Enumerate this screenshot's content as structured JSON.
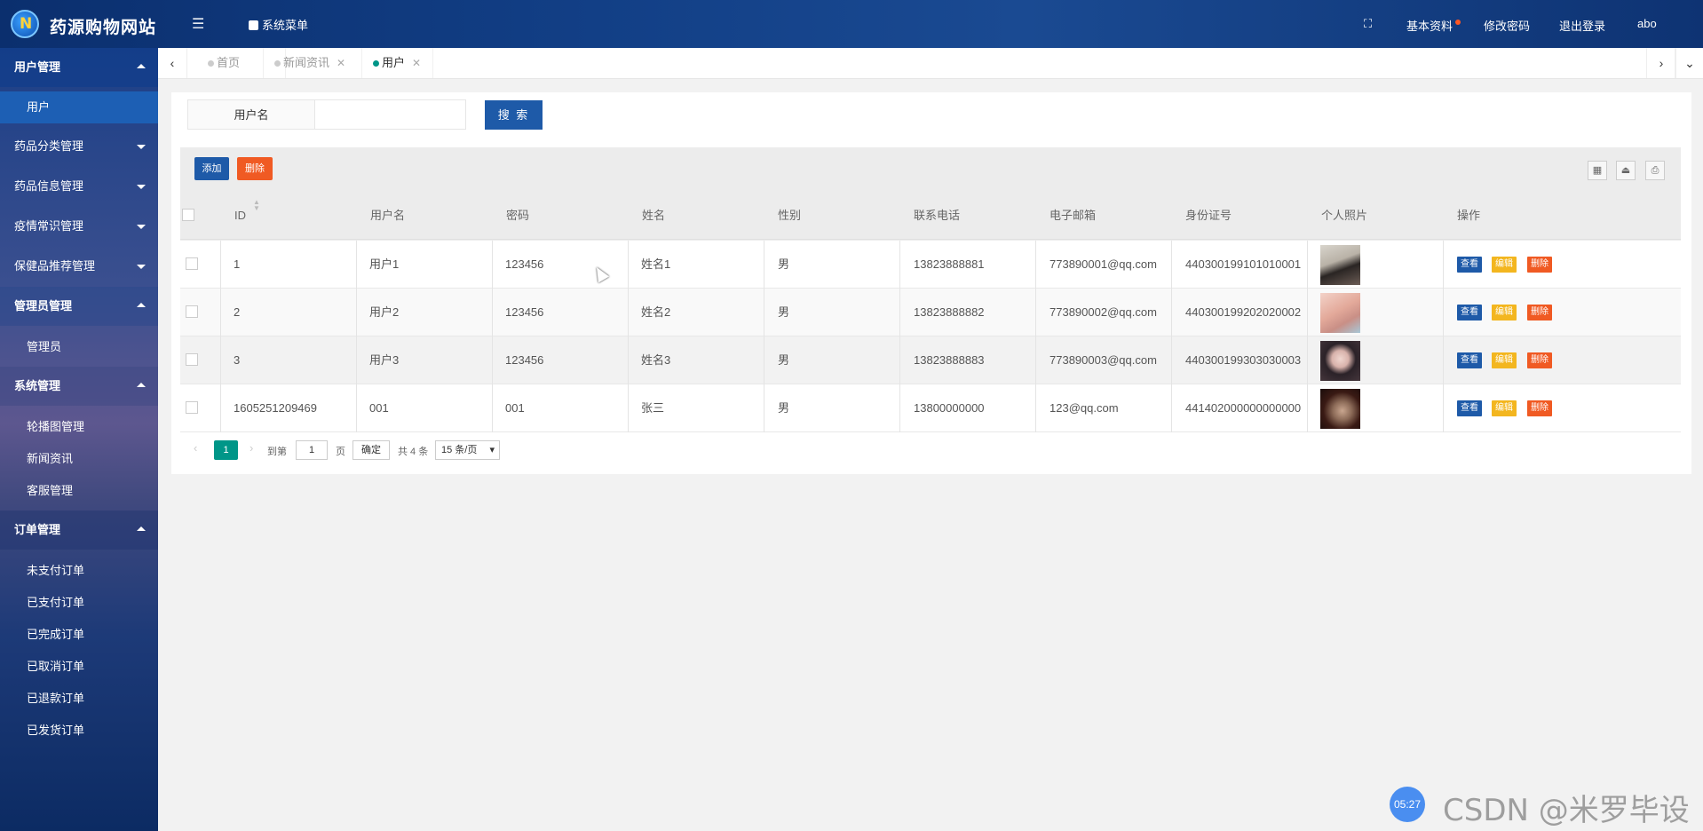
{
  "header": {
    "brand": "药源购物网站",
    "menu_toggle_icon": "list-icon",
    "system_menu": "系统菜单",
    "fullscreen_icon": "fullscreen-icon",
    "profile": "基本资料",
    "change_password": "修改密码",
    "logout": "退出登录",
    "username": "abo"
  },
  "sidebar": {
    "groups": [
      {
        "label": "用户管理",
        "items": [
          "用户"
        ]
      },
      {
        "label": "药品分类管理"
      },
      {
        "label": "药品信息管理"
      },
      {
        "label": "疫情常识管理"
      },
      {
        "label": "保健品推荐管理"
      },
      {
        "label": "管理员管理",
        "items": [
          "管理员"
        ]
      },
      {
        "label": "系统管理",
        "items": [
          "轮播图管理",
          "新闻资讯",
          "客服管理"
        ]
      },
      {
        "label": "订单管理",
        "items": [
          "未支付订单",
          "已支付订单",
          "已完成订单",
          "已取消订单",
          "已退款订单",
          "已发货订单"
        ]
      }
    ]
  },
  "tabs": [
    {
      "label": "首页"
    },
    {
      "label": "新闻资讯"
    },
    {
      "label": "用户"
    }
  ],
  "search": {
    "label": "用户名",
    "value": "",
    "button": "搜 索"
  },
  "toolbar": {
    "add": "添加",
    "delete": "删除",
    "icons": [
      "columns-icon",
      "export-icon",
      "print-icon"
    ]
  },
  "table": {
    "headers": [
      "ID",
      "用户名",
      "密码",
      "姓名",
      "性别",
      "联系电话",
      "电子邮箱",
      "身份证号",
      "个人照片",
      "操作"
    ],
    "rows": [
      {
        "id": "1",
        "username": "用户1",
        "password": "123456",
        "name": "姓名1",
        "gender": "男",
        "phone": "13823888881",
        "email": "773890001@qq.com",
        "idcard": "440300199101010001"
      },
      {
        "id": "2",
        "username": "用户2",
        "password": "123456",
        "name": "姓名2",
        "gender": "男",
        "phone": "13823888882",
        "email": "773890002@qq.com",
        "idcard": "440300199202020002"
      },
      {
        "id": "3",
        "username": "用户3",
        "password": "123456",
        "name": "姓名3",
        "gender": "男",
        "phone": "13823888883",
        "email": "773890003@qq.com",
        "idcard": "440300199303030003"
      },
      {
        "id": "1605251209469",
        "username": "001",
        "password": "001",
        "name": "张三",
        "gender": "男",
        "phone": "13800000000",
        "email": "123@qq.com",
        "idcard": "441402000000000000"
      }
    ],
    "actions": {
      "view": "查看",
      "edit": "编辑",
      "delete": "删除"
    }
  },
  "pagination": {
    "current": "1",
    "goto_label": "到第",
    "goto_value": "1",
    "page_unit": "页",
    "confirm": "确定",
    "total": "共 4 条",
    "page_size": "15 条/页"
  },
  "overlay": {
    "timer": "05:27",
    "watermark": "CSDN @米罗毕设"
  }
}
